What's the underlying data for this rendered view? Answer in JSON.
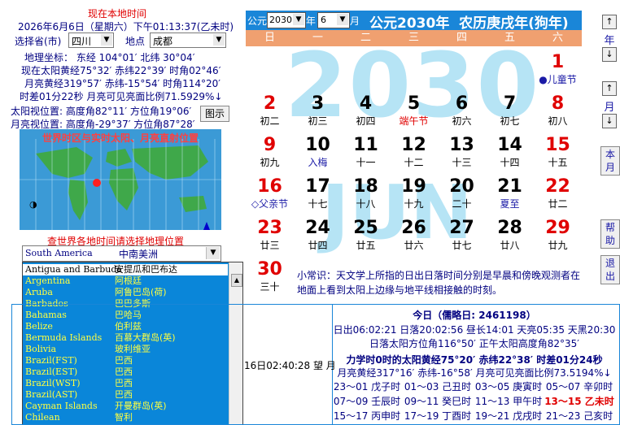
{
  "left": {
    "heading": "现在本地时间",
    "datetime": "2026年6月6日（星期六）下午01:13:37(乙未时)",
    "province_label": "选择省(市)",
    "province_value": "四川",
    "city_label": "地点",
    "city_value": "成都",
    "coords": "地理坐标： 东经 104°01′ 北纬 30°04′",
    "sun_line": "现在太阳黄经75°32′ 赤纬22°39′ 时角02°46′",
    "moon_line": "月亮黄经319°57′ 赤纬-15°54′ 时角114°20′",
    "diff_line": "时差01分22秒 月亮可见亮面比例71.5929%↓",
    "sun_pos": "太阳视位置: 高度角82°11′ 方位角19°06′",
    "moon_pos": "月亮视位置: 高度角-29°37′ 方位角87°28′",
    "map_button": "图示",
    "map_title": "世界时区与实时太阳、月亮直射位置",
    "world_prompt": "查世界各地时间请选择地理位置",
    "region_en": "South America",
    "region_zh": "中南美洲",
    "countries": [
      {
        "en": "Antigua and Barbuda",
        "zh": "安提瓜和巴布达"
      },
      {
        "en": "Argentina",
        "zh": "阿根廷"
      },
      {
        "en": "Aruba",
        "zh": "阿鲁巴岛(荷)"
      },
      {
        "en": "Barbados",
        "zh": "巴巴多斯"
      },
      {
        "en": "Bahamas",
        "zh": "巴哈马"
      },
      {
        "en": "Belize",
        "zh": "伯利兹"
      },
      {
        "en": "Bermuda Islands",
        "zh": "百慕大群岛(英)"
      },
      {
        "en": "Bolivia",
        "zh": "玻利维亚"
      },
      {
        "en": "Brazil(FST)",
        "zh": "巴西"
      },
      {
        "en": "Brazil(EST)",
        "zh": "巴西"
      },
      {
        "en": "Brazil(WST)",
        "zh": "巴西"
      },
      {
        "en": "Brazil(AST)",
        "zh": "巴西"
      },
      {
        "en": "Cayman Islands",
        "zh": "开曼群岛(英)"
      },
      {
        "en": "Chilean",
        "zh": "智利"
      }
    ]
  },
  "header": {
    "gongyuan": "公元",
    "year_value": "2030",
    "year_unit": "年",
    "month_value": "6",
    "month_unit": "月",
    "title": "公元2030年  农历庚戌年(狗年)"
  },
  "weekdays": [
    "日",
    "一",
    "二",
    "三",
    "四",
    "五",
    "六"
  ],
  "watermark_year": "2030",
  "watermark_month": "JUN",
  "days": [
    {
      "n": "1",
      "l": "●儿童节",
      "nc": "red",
      "lc": "blue"
    },
    {
      "n": "2",
      "l": "初二",
      "nc": "red",
      "lc": "black"
    },
    {
      "n": "3",
      "l": "初三",
      "nc": "black",
      "lc": "black"
    },
    {
      "n": "4",
      "l": "初四",
      "nc": "black",
      "lc": "black"
    },
    {
      "n": "5",
      "l": "端午节",
      "nc": "black",
      "lc": "red"
    },
    {
      "n": "6",
      "l": "初六",
      "nc": "black",
      "lc": "black"
    },
    {
      "n": "7",
      "l": "初七",
      "nc": "black",
      "lc": "black"
    },
    {
      "n": "8",
      "l": "初八",
      "nc": "red",
      "lc": "black"
    },
    {
      "n": "9",
      "l": "初九",
      "nc": "red",
      "lc": "black"
    },
    {
      "n": "10",
      "l": "入梅",
      "nc": "black",
      "lc": "blue"
    },
    {
      "n": "11",
      "l": "十一",
      "nc": "black",
      "lc": "black"
    },
    {
      "n": "12",
      "l": "十二",
      "nc": "black",
      "lc": "black"
    },
    {
      "n": "13",
      "l": "十三",
      "nc": "black",
      "lc": "black"
    },
    {
      "n": "14",
      "l": "十四",
      "nc": "black",
      "lc": "black"
    },
    {
      "n": "15",
      "l": "十五",
      "nc": "red",
      "lc": "black"
    },
    {
      "n": "16",
      "l": "◇父亲节",
      "nc": "red",
      "lc": "blue"
    },
    {
      "n": "17",
      "l": "十七",
      "nc": "black",
      "lc": "black"
    },
    {
      "n": "18",
      "l": "十八",
      "nc": "black",
      "lc": "black"
    },
    {
      "n": "19",
      "l": "十九",
      "nc": "black",
      "lc": "black"
    },
    {
      "n": "20",
      "l": "二十",
      "nc": "black",
      "lc": "black"
    },
    {
      "n": "21",
      "l": "夏至",
      "nc": "black",
      "lc": "blue"
    },
    {
      "n": "22",
      "l": "廿二",
      "nc": "red",
      "lc": "black"
    },
    {
      "n": "23",
      "l": "廿三",
      "nc": "red",
      "lc": "black"
    },
    {
      "n": "24",
      "l": "廿四",
      "nc": "black",
      "lc": "black"
    },
    {
      "n": "25",
      "l": "廿五",
      "nc": "black",
      "lc": "black"
    },
    {
      "n": "26",
      "l": "廿六",
      "nc": "black",
      "lc": "black"
    },
    {
      "n": "27",
      "l": "廿七",
      "nc": "black",
      "lc": "black"
    },
    {
      "n": "28",
      "l": "廿八",
      "nc": "black",
      "lc": "black"
    },
    {
      "n": "29",
      "l": "廿九",
      "nc": "red",
      "lc": "black"
    },
    {
      "n": "30",
      "l": "三十",
      "nc": "red",
      "lc": "black"
    }
  ],
  "side": {
    "year_label": "年",
    "month_label": "月",
    "this_month": "本月",
    "help": "帮助",
    "exit": "退出"
  },
  "knowledge": "小常识：天文学上所指的日出日落时间分别是早晨和傍晚观测者在地面上看到太阳上边缘与地平线相接触的时刻。",
  "bottom_left_fragment": "16日02:40:28 望 月",
  "today": {
    "title": "今日（儒略日: 2461198）",
    "l1": "日出06:02:21 日落20:02:56 昼长14:01 天亮05:35 天黑20:30",
    "l2": "日落太阳方位角116°50′ 正午太阳高度角82°35′",
    "l3": "力学时0时的太阳黄经75°20′ 赤纬22°38′ 时差01分24秒",
    "l4": "月亮黄经317°16′ 赤纬-16°58′ 月亮可见亮面比例73.5194%↓",
    "hours": [
      "23～01 戊子时",
      "01～03 己丑时",
      "03～05 庚寅时",
      "05～07 辛卯时",
      "07～09 壬辰时",
      "09～11 癸巳时",
      "11～13 甲午时",
      "13～15 乙未时",
      "15～17 丙申时",
      "17～19 丁酉时",
      "19～21 戊戌时",
      "21～23 己亥时"
    ],
    "current_hour_index": 7
  },
  "colors": {
    "header_blue": "#1a86d8",
    "weekbar_orange": "#f0a070",
    "watermark": "#b6e4f5",
    "list_bg": "#0a86d9",
    "list_text": "#ffff40"
  }
}
